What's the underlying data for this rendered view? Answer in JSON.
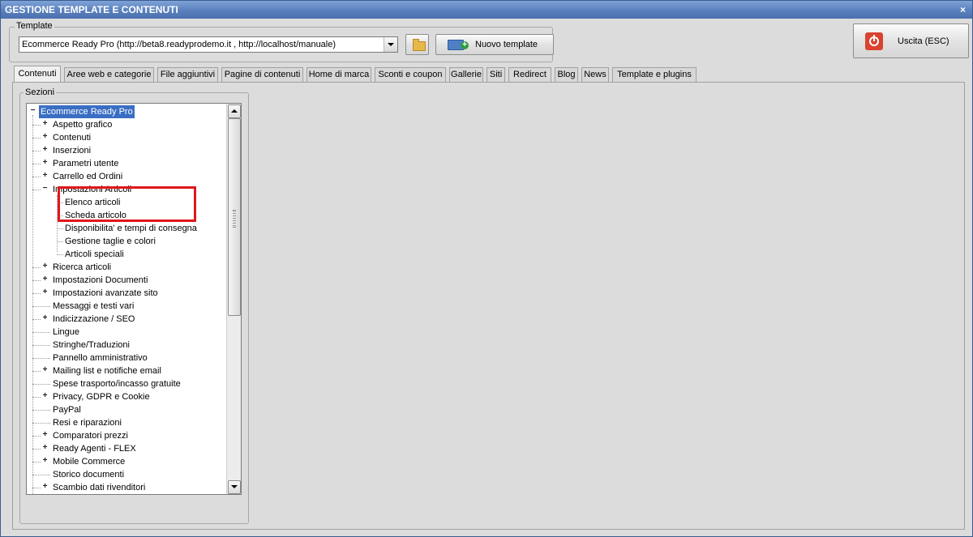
{
  "window": {
    "title": "GESTIONE TEMPLATE E CONTENUTI",
    "close_glyph": "×"
  },
  "template": {
    "group_label": "Template",
    "selected": "Ecommerce Ready Pro (http://beta8.readyprodemo.it , http://localhost/manuale)",
    "folder_icon": "folder-icon",
    "new_button_label": "Nuovo template",
    "new_icon": "new-template-icon"
  },
  "exit_button": {
    "label": "Uscita (ESC)",
    "icon": "power-icon",
    "icon_color": "#d9432f"
  },
  "tabs": [
    {
      "label": "Contenuti",
      "active": true
    },
    {
      "label": "Aree web e categorie"
    },
    {
      "label": "File aggiuntivi"
    },
    {
      "label": "Pagine di contenuti"
    },
    {
      "label": "Home di marca"
    },
    {
      "label": "Sconti e coupon"
    },
    {
      "label": "Gallerie"
    },
    {
      "label": "Siti"
    },
    {
      "label": "Redirect"
    },
    {
      "label": "Blog"
    },
    {
      "label": "News"
    },
    {
      "label": "Template e plugins"
    }
  ],
  "sezioni": {
    "group_label": "Sezioni",
    "root": {
      "label": "Ecommerce Ready Pro",
      "expanded": true,
      "selected": true
    },
    "items": [
      {
        "label": "Aspetto grafico",
        "expandable": true
      },
      {
        "label": "Contenuti",
        "expandable": true
      },
      {
        "label": "Inserzioni",
        "expandable": true
      },
      {
        "label": "Parametri utente",
        "expandable": true
      },
      {
        "label": "Carrello ed Ordini",
        "expandable": true
      },
      {
        "label": "Impostazioni Articoli",
        "expandable": true,
        "expanded": true
      },
      {
        "label": "Elenco articoli",
        "child": true
      },
      {
        "label": "Scheda articolo",
        "child": true
      },
      {
        "label": "Disponibilita' e tempi di consegna",
        "child": true
      },
      {
        "label": "Gestione taglie e colori",
        "child": true
      },
      {
        "label": "Articoli speciali",
        "child": true
      },
      {
        "label": "Ricerca articoli",
        "expandable": true
      },
      {
        "label": "Impostazioni Documenti",
        "expandable": true
      },
      {
        "label": "Impostazioni avanzate sito",
        "expandable": true
      },
      {
        "label": "Messaggi e testi vari"
      },
      {
        "label": "Indicizzazione / SEO",
        "expandable": true
      },
      {
        "label": "Lingue"
      },
      {
        "label": "Stringhe/Traduzioni"
      },
      {
        "label": "Pannello amministrativo"
      },
      {
        "label": "Mailing list e notifiche email",
        "expandable": true
      },
      {
        "label": "Spese trasporto/incasso gratuite"
      },
      {
        "label": "Privacy, GDPR e Cookie",
        "expandable": true
      },
      {
        "label": "PayPal"
      },
      {
        "label": "Resi e riparazioni"
      },
      {
        "label": "Comparatori prezzi",
        "expandable": true
      },
      {
        "label": "Ready Agenti - FLEX",
        "expandable": true
      },
      {
        "label": "Mobile Commerce",
        "expandable": true
      },
      {
        "label": "Storico documenti"
      },
      {
        "label": "Scambio dati rivenditori",
        "expandable": true
      }
    ]
  },
  "highlight_color": "#e0171b"
}
